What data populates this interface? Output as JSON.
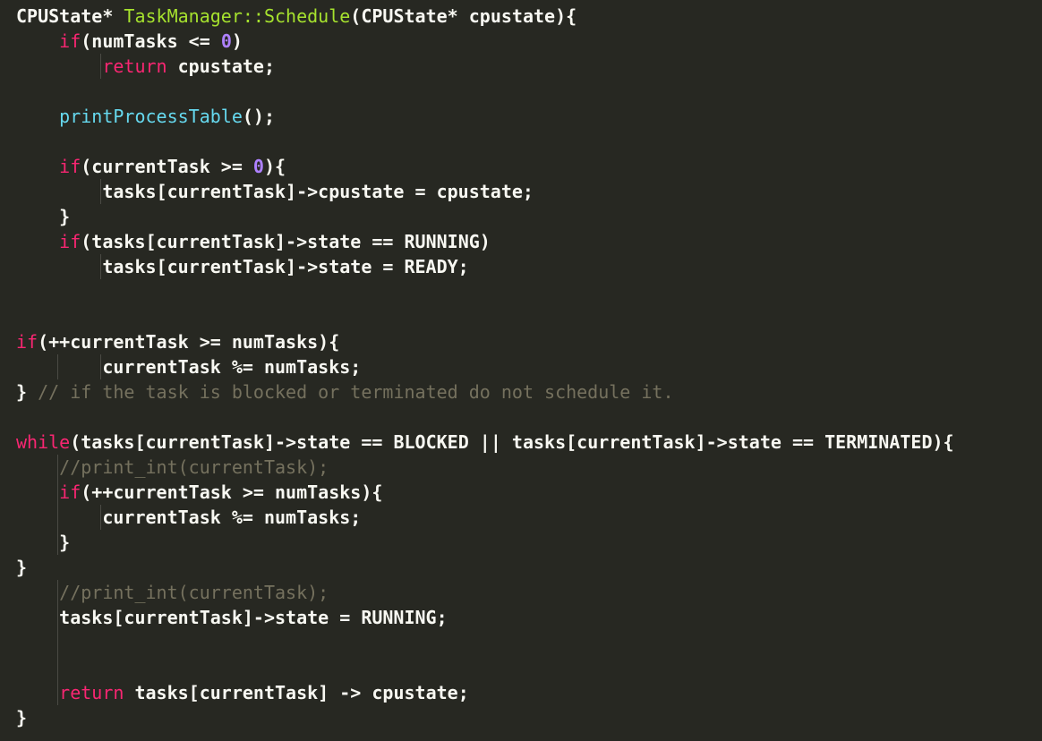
{
  "colors": {
    "background": "#272822",
    "default": "#F8F8F2",
    "keyword": "#F92672",
    "function": "#66D9EF",
    "number": "#AE81FF",
    "comment": "#75715E",
    "class": "#A6E22E"
  },
  "code": [
    [
      {
        "t": "CPUState* ",
        "c": "default"
      },
      {
        "t": "TaskManager::Schedule",
        "c": "class"
      },
      {
        "t": "(CPUState* cpustate){",
        "c": "default"
      }
    ],
    [
      {
        "t": "    ",
        "c": "default"
      },
      {
        "t": "if",
        "c": "keyword"
      },
      {
        "t": "(numTasks <= ",
        "c": "default"
      },
      {
        "t": "0",
        "c": "number"
      },
      {
        "t": ")",
        "c": "default"
      }
    ],
    [
      {
        "t": "        ",
        "c": "default"
      },
      {
        "t": "return",
        "c": "keyword"
      },
      {
        "t": " cpustate;",
        "c": "default"
      }
    ],
    [],
    [
      {
        "t": "    ",
        "c": "default"
      },
      {
        "t": "printProcessTable",
        "c": "function"
      },
      {
        "t": "();",
        "c": "default"
      }
    ],
    [],
    [
      {
        "t": "    ",
        "c": "default"
      },
      {
        "t": "if",
        "c": "keyword"
      },
      {
        "t": "(currentTask >= ",
        "c": "default"
      },
      {
        "t": "0",
        "c": "number"
      },
      {
        "t": "){",
        "c": "default"
      }
    ],
    [
      {
        "t": "        tasks[currentTask]->cpustate = cpustate;",
        "c": "default"
      }
    ],
    [
      {
        "t": "    }",
        "c": "default"
      }
    ],
    [
      {
        "t": "    ",
        "c": "default"
      },
      {
        "t": "if",
        "c": "keyword"
      },
      {
        "t": "(tasks[currentTask]->state == RUNNING)",
        "c": "default"
      }
    ],
    [
      {
        "t": "        tasks[currentTask]->state = READY;",
        "c": "default"
      }
    ],
    [],
    [],
    [
      {
        "t": "if",
        "c": "keyword"
      },
      {
        "t": "(++currentTask >= numTasks){",
        "c": "default"
      }
    ],
    [
      {
        "t": "        currentTask %= numTasks;",
        "c": "default"
      }
    ],
    [
      {
        "t": "} ",
        "c": "default"
      },
      {
        "t": "// if the task is blocked or terminated do not schedule it.",
        "c": "comment"
      }
    ],
    [],
    [
      {
        "t": "while",
        "c": "keyword"
      },
      {
        "t": "(tasks[currentTask]->state == BLOCKED || tasks[currentTask]->state == TERMINATED){",
        "c": "default"
      }
    ],
    [
      {
        "t": "    ",
        "c": "default"
      },
      {
        "t": "//print_int(currentTask);",
        "c": "comment"
      }
    ],
    [
      {
        "t": "    ",
        "c": "default"
      },
      {
        "t": "if",
        "c": "keyword"
      },
      {
        "t": "(++currentTask >= numTasks){",
        "c": "default"
      }
    ],
    [
      {
        "t": "        currentTask %= numTasks;",
        "c": "default"
      }
    ],
    [
      {
        "t": "    }",
        "c": "default"
      }
    ],
    [
      {
        "t": "}",
        "c": "default"
      }
    ],
    [
      {
        "t": "    ",
        "c": "default"
      },
      {
        "t": "//print_int(currentTask);",
        "c": "comment"
      }
    ],
    [
      {
        "t": "    tasks[currentTask]->state = RUNNING;",
        "c": "default"
      }
    ],
    [],
    [],
    [
      {
        "t": "    ",
        "c": "default"
      },
      {
        "t": "return",
        "c": "keyword"
      },
      {
        "t": " tasks[currentTask] -> cpustate;",
        "c": "default"
      }
    ],
    [
      {
        "t": "}",
        "c": "default"
      }
    ]
  ]
}
